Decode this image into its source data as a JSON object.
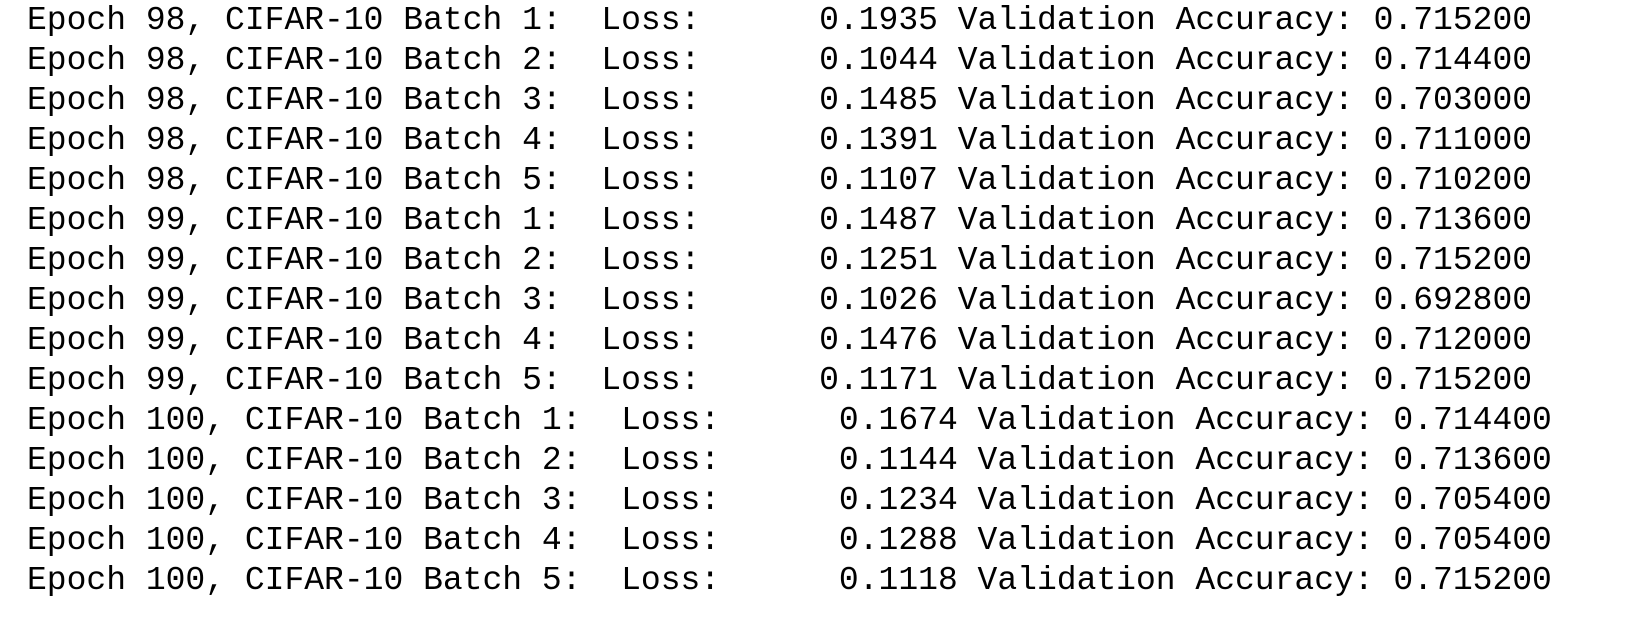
{
  "console": {
    "lines": [
      "Epoch 98, CIFAR-10 Batch 1:  Loss:      0.1935 Validation Accuracy: 0.715200",
      "Epoch 98, CIFAR-10 Batch 2:  Loss:      0.1044 Validation Accuracy: 0.714400",
      "Epoch 98, CIFAR-10 Batch 3:  Loss:      0.1485 Validation Accuracy: 0.703000",
      "Epoch 98, CIFAR-10 Batch 4:  Loss:      0.1391 Validation Accuracy: 0.711000",
      "Epoch 98, CIFAR-10 Batch 5:  Loss:      0.1107 Validation Accuracy: 0.710200",
      "Epoch 99, CIFAR-10 Batch 1:  Loss:      0.1487 Validation Accuracy: 0.713600",
      "Epoch 99, CIFAR-10 Batch 2:  Loss:      0.1251 Validation Accuracy: 0.715200",
      "Epoch 99, CIFAR-10 Batch 3:  Loss:      0.1026 Validation Accuracy: 0.692800",
      "Epoch 99, CIFAR-10 Batch 4:  Loss:      0.1476 Validation Accuracy: 0.712000",
      "Epoch 99, CIFAR-10 Batch 5:  Loss:      0.1171 Validation Accuracy: 0.715200",
      "Epoch 100, CIFAR-10 Batch 1:  Loss:      0.1674 Validation Accuracy: 0.714400",
      "Epoch 100, CIFAR-10 Batch 2:  Loss:      0.1144 Validation Accuracy: 0.713600",
      "Epoch 100, CIFAR-10 Batch 3:  Loss:      0.1234 Validation Accuracy: 0.705400",
      "Epoch 100, CIFAR-10 Batch 4:  Loss:      0.1288 Validation Accuracy: 0.705400",
      "Epoch 100, CIFAR-10 Batch 5:  Loss:      0.1118 Validation Accuracy: 0.715200"
    ]
  }
}
